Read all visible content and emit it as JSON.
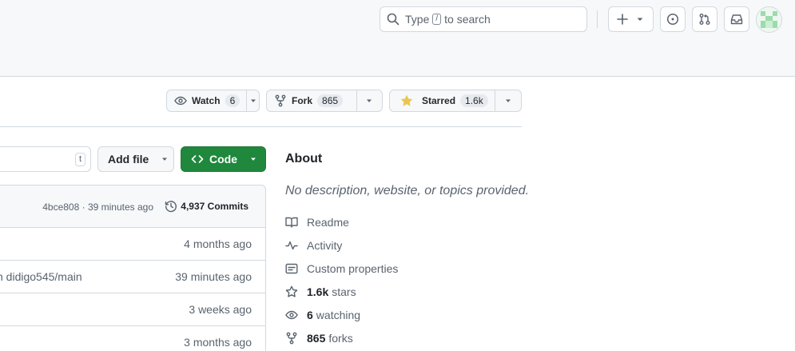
{
  "header": {
    "search": {
      "before": "Type",
      "key": "/",
      "after": "to search"
    }
  },
  "repo_actions": {
    "watch": {
      "label": "Watch",
      "count": "6"
    },
    "fork": {
      "label": "Fork",
      "count": "865"
    },
    "star": {
      "label": "Starred",
      "count": "1.6k",
      "star_color": "#eac54f"
    }
  },
  "toolbar": {
    "go_to_file_key": "t",
    "add_file_label": "Add file",
    "code_label": "Code",
    "code_color": "#1f883d"
  },
  "latest_commit": {
    "meta": "4bce808 · 39 minutes ago",
    "commits_label": "4,937 Commits"
  },
  "files": [
    {
      "message": "",
      "age": "4 months ago"
    },
    {
      "message": "n didigo545/main",
      "age": "39 minutes ago"
    },
    {
      "message": "",
      "age": "3 weeks ago"
    },
    {
      "message": "",
      "age": "3 months ago"
    }
  ],
  "about": {
    "title": "About",
    "description": "No description, website, or topics provided.",
    "readme": "Readme",
    "activity": "Activity",
    "custom_properties": "Custom properties",
    "stars_count": "1.6k",
    "stars_label": "stars",
    "watching_count": "6",
    "watching_label": "watching",
    "forks_count": "865",
    "forks_label": "forks"
  }
}
